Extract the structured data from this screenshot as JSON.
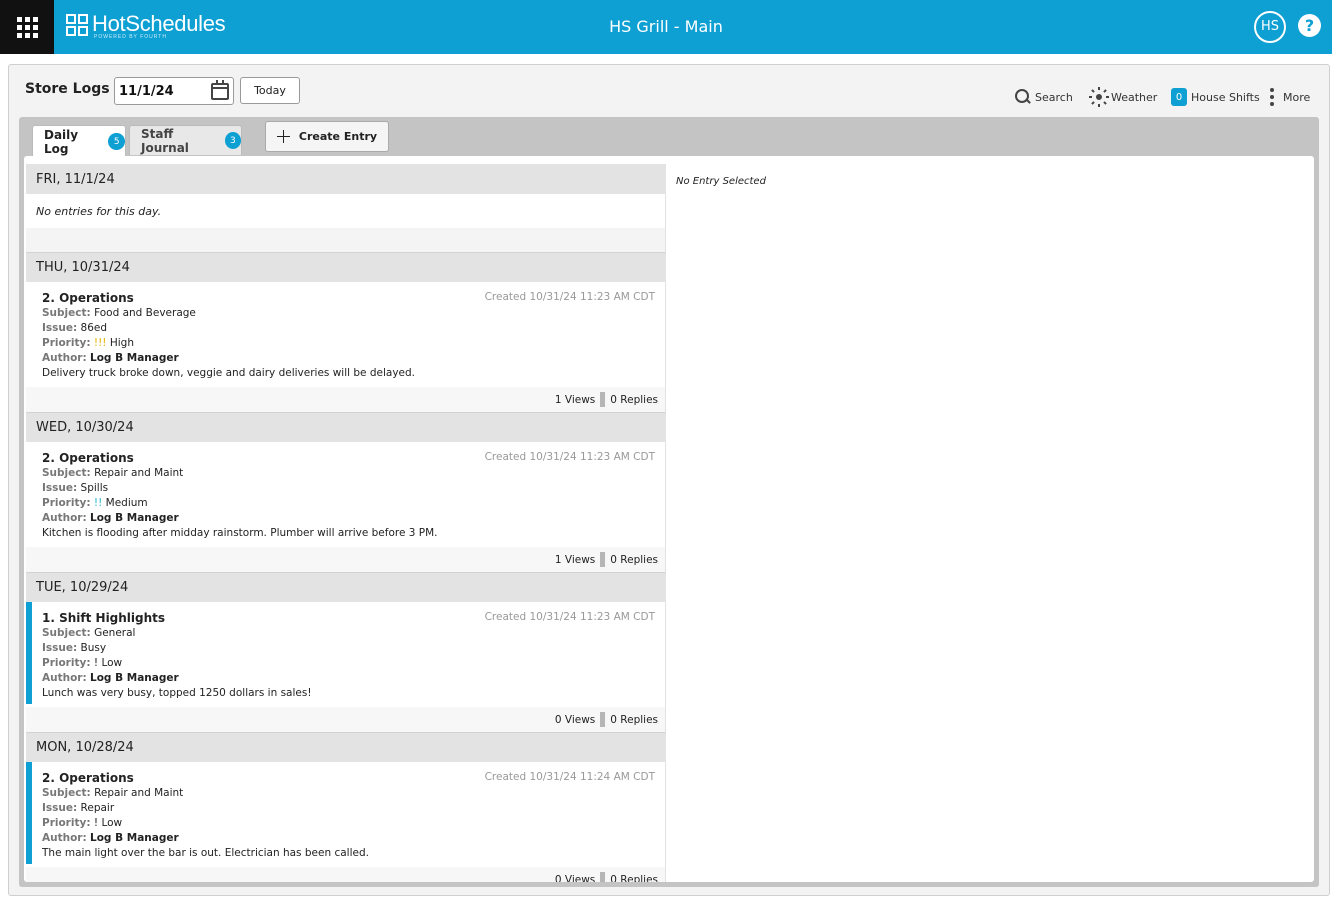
{
  "app": {
    "logo_text": "HotSchedules",
    "logo_sub": "POWERED BY FOURTH",
    "store_name": "HS Grill - Main",
    "user_initials": "HS",
    "help_label": "?",
    "brand_color": "#0e9fd3"
  },
  "page": {
    "title": "Store Logs",
    "date_value": "11/1/24",
    "today_label": "Today"
  },
  "toolbar": {
    "search_label": "Search",
    "weather_label": "Weather",
    "house_shifts_count": "0",
    "house_shifts_label": "House Shifts",
    "more_label": "More"
  },
  "tabs": [
    {
      "label": "Daily Log",
      "count": "5",
      "active": true
    },
    {
      "label": "Staff Journal",
      "count": "3",
      "active": false
    }
  ],
  "create_entry_label": "Create Entry",
  "detail": {
    "empty_text": "No Entry Selected"
  },
  "days": [
    {
      "header": "FRI, 11/1/24",
      "empty_text": "No entries for this day.",
      "entry": null
    },
    {
      "header": "THU, 10/31/24",
      "entry": {
        "title": "2. Operations",
        "created": "Created 10/31/24 11:23 AM CDT",
        "subject_label": "Subject:",
        "subject": "Food and Beverage",
        "issue_label": "Issue:",
        "issue": "86ed",
        "priority_label": "Priority:",
        "priority_marks": "!!!",
        "priority": "High",
        "author_label": "Author:",
        "author": "Log B Manager",
        "body": "Delivery truck broke down, veggie and dairy deliveries will be delayed.",
        "views": "1 Views",
        "replies": "0 Replies",
        "flagged": false
      }
    },
    {
      "header": "WED, 10/30/24",
      "entry": {
        "title": "2. Operations",
        "created": "Created 10/31/24 11:23 AM CDT",
        "subject_label": "Subject:",
        "subject": "Repair and Maint",
        "issue_label": "Issue:",
        "issue": "Spills",
        "priority_label": "Priority:",
        "priority_marks": "!!",
        "priority": "Medium",
        "author_label": "Author:",
        "author": "Log B Manager",
        "body": "Kitchen is flooding after midday rainstorm. Plumber will arrive before 3 PM.",
        "views": "1 Views",
        "replies": "0 Replies",
        "flagged": false
      }
    },
    {
      "header": "TUE, 10/29/24",
      "entry": {
        "title": "1. Shift Highlights",
        "created": "Created 10/31/24 11:23 AM CDT",
        "subject_label": "Subject:",
        "subject": "General",
        "issue_label": "Issue:",
        "issue": "Busy",
        "priority_label": "Priority:",
        "priority_marks": "!",
        "priority": "Low",
        "author_label": "Author:",
        "author": "Log B Manager",
        "body": "Lunch was very busy, topped 1250 dollars in sales!",
        "views": "0 Views",
        "replies": "0 Replies",
        "flagged": true
      }
    },
    {
      "header": "MON, 10/28/24",
      "entry": {
        "title": "2. Operations",
        "created": "Created 10/31/24 11:24 AM CDT",
        "subject_label": "Subject:",
        "subject": "Repair and Maint",
        "issue_label": "Issue:",
        "issue": "Repair",
        "priority_label": "Priority:",
        "priority_marks": "!",
        "priority": "Low",
        "author_label": "Author:",
        "author": "Log B Manager",
        "body": "The main light over the bar is out. Electrician has been called.",
        "views": "0 Views",
        "replies": "0 Replies",
        "flagged": true
      }
    }
  ]
}
